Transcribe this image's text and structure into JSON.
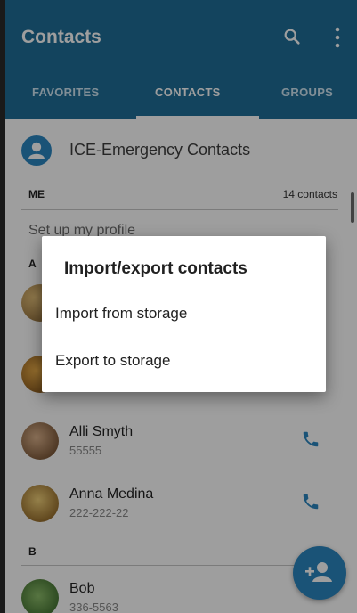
{
  "app_bar": {
    "title": "Contacts",
    "tabs": [
      {
        "label": "FAVORITES",
        "active": false
      },
      {
        "label": "CONTACTS",
        "active": true
      },
      {
        "label": "GROUPS",
        "active": false
      }
    ],
    "color": "#1f6f98"
  },
  "list": {
    "ice_label": "ICE-Emergency Contacts",
    "me_header": "ME",
    "contact_count": "14 contacts",
    "profile_prompt": "Set up my profile",
    "section_a": "A",
    "section_b": "B",
    "contacts": [
      {
        "name": "Alli Smyth",
        "phone": "55555"
      },
      {
        "name": "Anna Medina",
        "phone": "222-222-22"
      },
      {
        "name": "Bob",
        "phone": "336-5563"
      }
    ]
  },
  "dialog": {
    "title": "Import/export contacts",
    "items": [
      "Import from storage",
      "Export to storage"
    ]
  },
  "icons": {
    "search": "search-icon",
    "overflow": "overflow-menu-icon",
    "call": "phone-icon",
    "fab": "add-contact-icon",
    "ice": "person-icon"
  },
  "colors": {
    "accent": "#2b86c1",
    "scrim": "rgba(0,0,0,0.38)"
  }
}
